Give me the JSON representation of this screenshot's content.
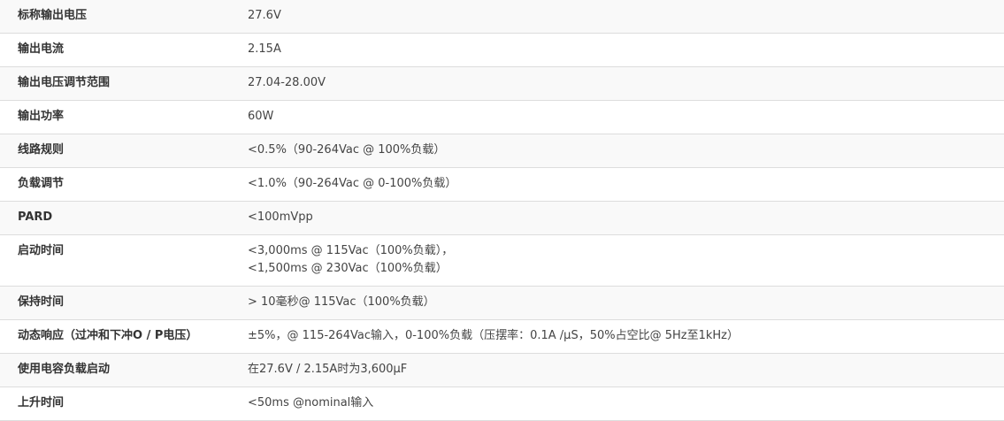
{
  "specs": [
    {
      "label": "标称输出电压",
      "value": [
        "27.6V"
      ]
    },
    {
      "label": "输出电流",
      "value": [
        "2.15A"
      ]
    },
    {
      "label": "输出电压调节范围",
      "value": [
        "27.04-28.00V"
      ]
    },
    {
      "label": "输出功率",
      "value": [
        "60W"
      ]
    },
    {
      "label": "线路规则",
      "value": [
        "<0.5%（90-264Vac @ 100%负载）"
      ]
    },
    {
      "label": "负载调节",
      "value": [
        "<1.0%（90-264Vac @ 0-100%负载）"
      ]
    },
    {
      "label": "PARD",
      "value": [
        "<100mVpp"
      ]
    },
    {
      "label": "启动时间",
      "value": [
        "<3,000ms @ 115Vac（100%负载），",
        "<1,500ms @ 230Vac（100%负载）"
      ]
    },
    {
      "label": "保持时间",
      "value": [
        "> 10毫秒@ 115Vac（100%负载）"
      ]
    },
    {
      "label": "动态响应（过冲和下冲O / P电压）",
      "value": [
        "±5%，@ 115-264Vac输入，0-100%负载（压摆率：0.1A /µS，50%占空比@ 5Hz至1kHz）"
      ]
    },
    {
      "label": "使用电容负载启动",
      "value": [
        "在27.6V / 2.15A时为3,600µF"
      ]
    },
    {
      "label": "上升时间",
      "value": [
        "<50ms @nominal输入"
      ]
    }
  ]
}
